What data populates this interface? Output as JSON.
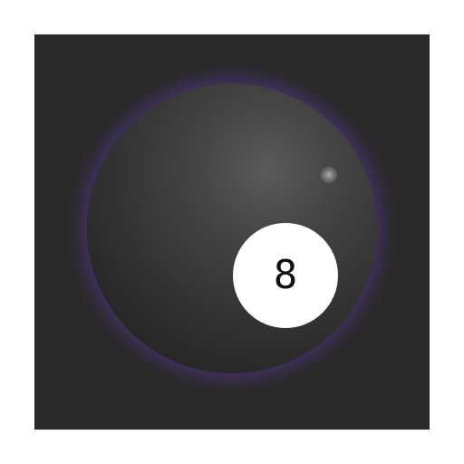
{
  "ball": {
    "number": "8"
  },
  "colors": {
    "background": "#2a2a2a",
    "ball": "#333333",
    "glow": "#5f379b",
    "window": "#ffffff"
  }
}
